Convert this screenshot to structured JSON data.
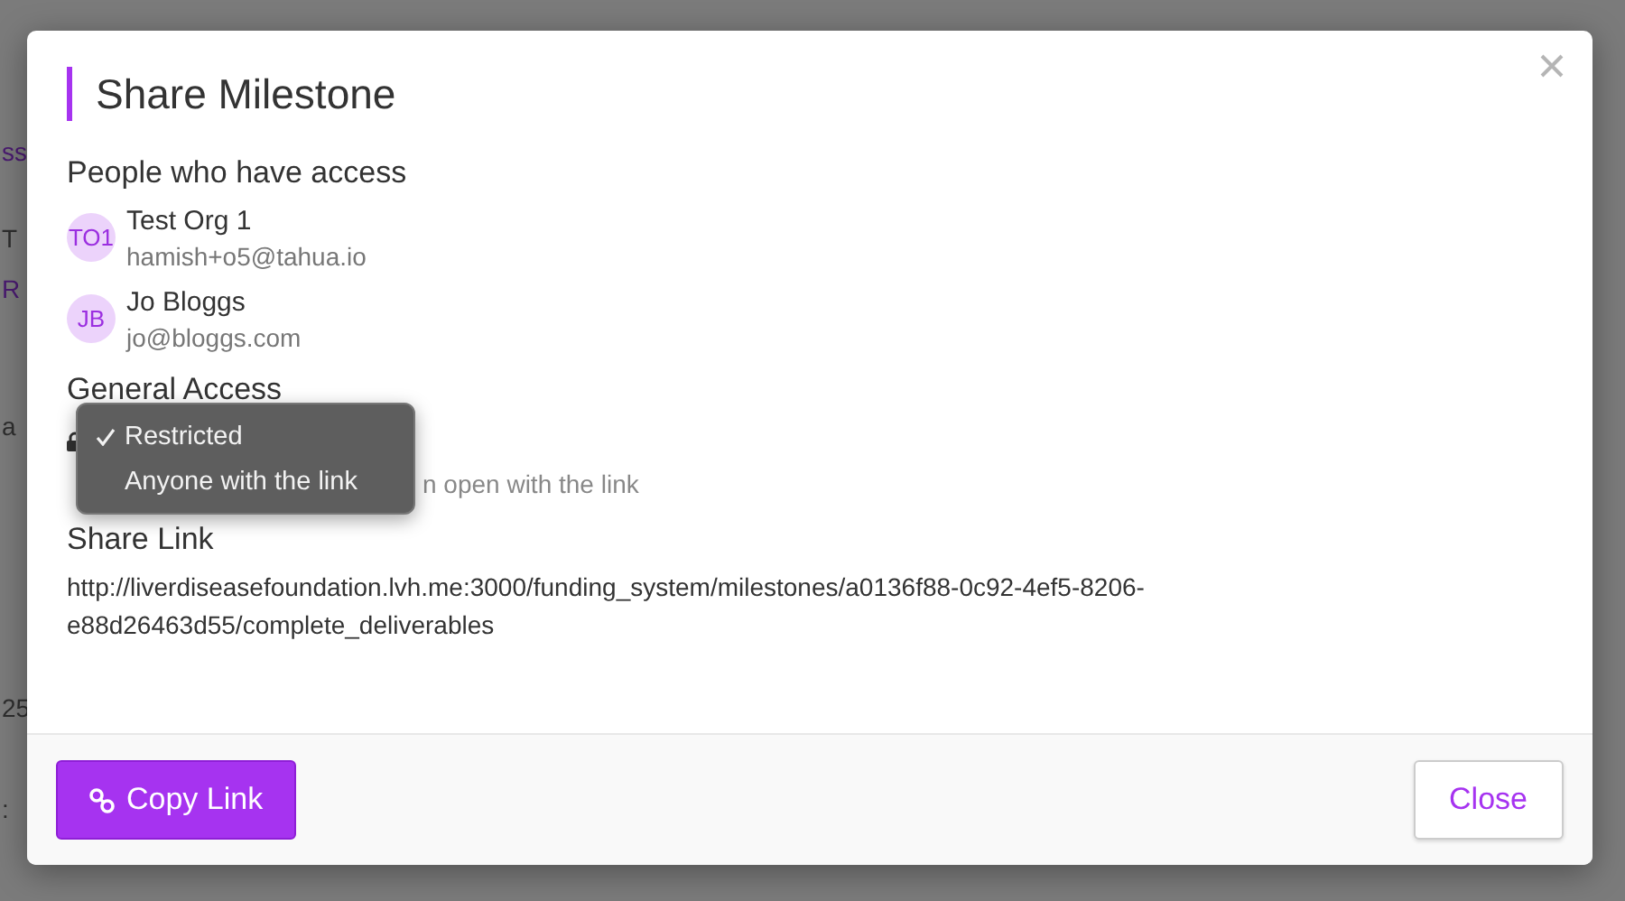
{
  "background_fragments": [
    {
      "text": "ss",
      "kind": "link"
    },
    {
      "text": "T",
      "kind": "text"
    },
    {
      "text": "R",
      "kind": "link"
    },
    {
      "text": "a",
      "kind": "text"
    },
    {
      "text": "25",
      "kind": "text"
    },
    {
      "text": ":",
      "kind": "text"
    }
  ],
  "dialog": {
    "title": "Share Milestone",
    "people_heading": "People who have access",
    "people": [
      {
        "initials": "TO1",
        "name": "Test Org 1",
        "email": "hamish+o5@tahua.io"
      },
      {
        "initials": "JB",
        "name": "Jo Bloggs",
        "email": "jo@bloggs.com"
      }
    ],
    "general_access_heading": "General Access",
    "access_menu": [
      {
        "label": "Restricted",
        "selected": true
      },
      {
        "label": "Anyone with the link",
        "selected": false
      }
    ],
    "access_description_visible": "n open with the link",
    "share_link_heading": "Share Link",
    "share_link": "http://liverdiseasefoundation.lvh.me:3000/funding_system/milestones/a0136f88-0c92-4ef5-8206-e88d26463d55/complete_deliverables",
    "buttons": [
      {
        "label": "Copy Link",
        "kind": "primary"
      },
      {
        "label": "Close",
        "kind": "secondary"
      }
    ]
  }
}
